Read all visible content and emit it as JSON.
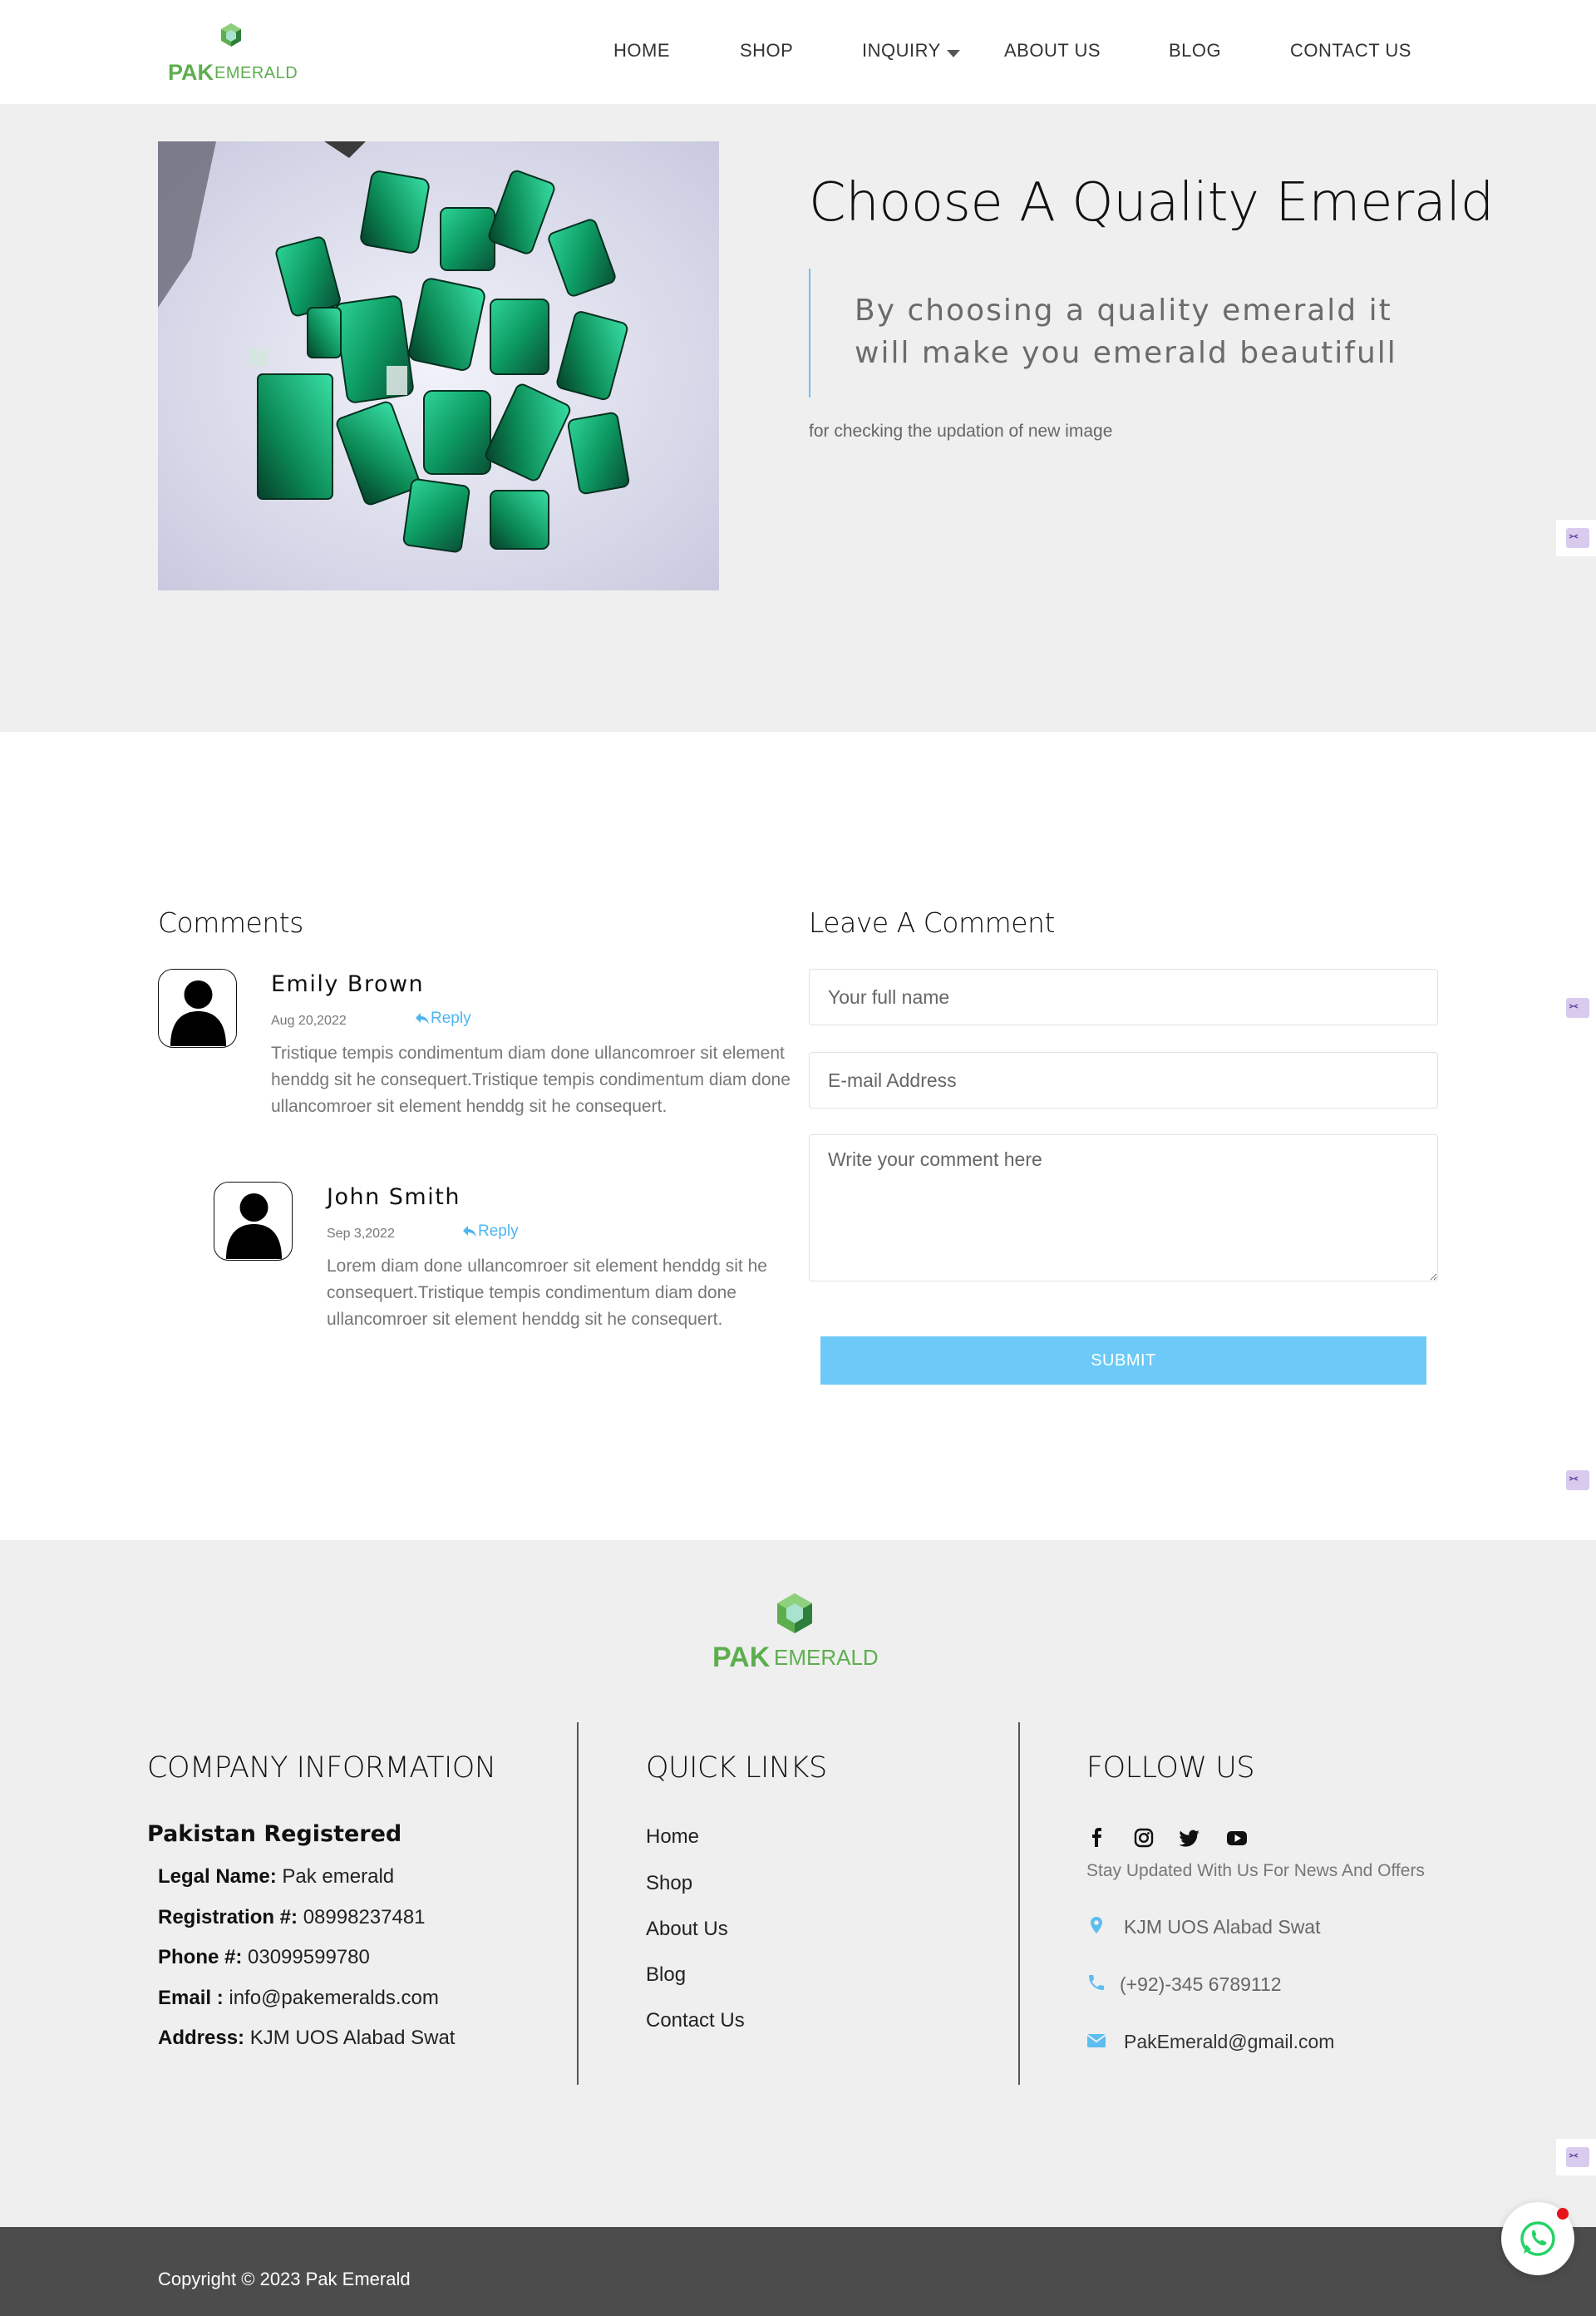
{
  "brand": {
    "logo_part1": "PAK",
    "logo_part2": "EMERALD",
    "green": "#5dae4e",
    "accent": "#67c3f3"
  },
  "nav": {
    "items": [
      {
        "label": "HOME"
      },
      {
        "label": "SHOP"
      },
      {
        "label": "INQUIRY"
      },
      {
        "label": "ABOUT US"
      },
      {
        "label": "BLOG"
      },
      {
        "label": "CONTACT US"
      }
    ],
    "inquiry_icon": "caret-down-icon"
  },
  "hero": {
    "title": "Choose A Quality Emerald",
    "quote_line1": "By choosing a quality emerald it",
    "quote_line2": "will make you emerald beautifull",
    "subtitle": "for checking the updation of new image"
  },
  "comments": {
    "heading": "Comments",
    "items": [
      {
        "name": "Emily Brown",
        "date": "Aug 20,2022",
        "reply": "Reply",
        "text": "Tristique tempis condimentum diam done ullancomroer sit element henddg sit he consequert.Tristique tempis condimentum diam done ullancomroer sit element henddg sit he consequert."
      },
      {
        "name": "John Smith",
        "date": "Sep 3,2022",
        "reply": "Reply",
        "text": "Lorem diam done ullancomroer sit element henddg sit he consequert.Tristique tempis condimentum diam done ullancomroer sit element henddg sit he consequert."
      }
    ]
  },
  "form": {
    "heading": "Leave A Comment",
    "name_placeholder": "Your full name",
    "email_placeholder": "E-mail Address",
    "comment_placeholder": "Write your comment here",
    "submit": "SUBMIT"
  },
  "footer": {
    "company": {
      "heading": "COMPANY INFORMATION",
      "subheading": "Pakistan Registered",
      "rows": [
        {
          "label": "Legal Name:",
          "value": "Pak emerald"
        },
        {
          "label": "Registration #:",
          "value": "08998237481"
        },
        {
          "label": "Phone #:",
          "value": "03099599780"
        },
        {
          "label": "Email :",
          "value": "info@pakemeralds.com"
        },
        {
          "label": "Address:",
          "value": "KJM UOS Alabad Swat"
        }
      ]
    },
    "quick_links": {
      "heading": "QUICK LINKS",
      "items": [
        "Home",
        "Shop",
        "About Us",
        "Blog",
        "Contact Us"
      ]
    },
    "follow": {
      "heading": "FOLLOW US",
      "social_icons": [
        "facebook-icon",
        "instagram-icon",
        "twitter-icon",
        "youtube-icon"
      ],
      "tagline": "Stay Updated With Us For News And Offers",
      "address": "KJM UOS Alabad Swat",
      "phone": "(+92)-345 6789112",
      "email": "PakEmerald@gmail.com"
    },
    "copyright": "Copyright © 2023 Pak Emerald"
  }
}
